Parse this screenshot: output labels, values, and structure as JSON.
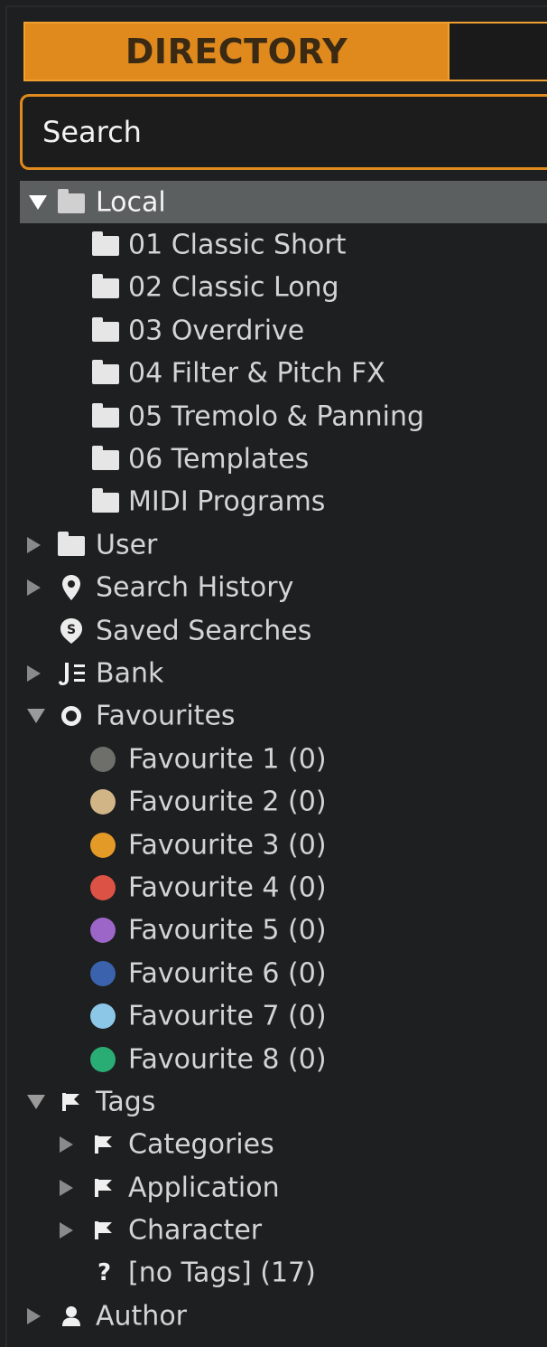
{
  "header": {
    "active_tab_label": "DIRECTORY"
  },
  "search": {
    "placeholder": "Search"
  },
  "tree": {
    "local": {
      "label": "Local",
      "children": [
        {
          "label": "01 Classic Short"
        },
        {
          "label": "02 Classic Long"
        },
        {
          "label": "03 Overdrive"
        },
        {
          "label": "04 Filter & Pitch FX"
        },
        {
          "label": "05 Tremolo & Panning"
        },
        {
          "label": "06 Templates"
        },
        {
          "label": "MIDI Programs"
        }
      ]
    },
    "user": {
      "label": "User"
    },
    "search_history": {
      "label": "Search History"
    },
    "saved_searches": {
      "label": "Saved Searches"
    },
    "bank": {
      "label": "Bank"
    },
    "favourites": {
      "label": "Favourites",
      "children": [
        {
          "label": "Favourite 1 (0)",
          "color": "#6e6e6a"
        },
        {
          "label": "Favourite 2 (0)",
          "color": "#d1b587"
        },
        {
          "label": "Favourite 3 (0)",
          "color": "#e49a26"
        },
        {
          "label": "Favourite 4 (0)",
          "color": "#dc5244"
        },
        {
          "label": "Favourite 5 (0)",
          "color": "#9b66c8"
        },
        {
          "label": "Favourite 6 (0)",
          "color": "#3a62ad"
        },
        {
          "label": "Favourite 7 (0)",
          "color": "#8cc7e8"
        },
        {
          "label": "Favourite 8 (0)",
          "color": "#2aad74"
        }
      ]
    },
    "tags": {
      "label": "Tags",
      "children": [
        {
          "label": "Categories"
        },
        {
          "label": "Application"
        },
        {
          "label": "Character"
        }
      ],
      "no_tags": {
        "label": "[no Tags] (17)"
      }
    },
    "author": {
      "label": "Author"
    }
  },
  "icons": {
    "folder": "folder-icon",
    "pin": "location-pin-icon",
    "saved_search": "saved-search-badge-icon",
    "bank": "bank-list-icon",
    "favourite": "circle-ring-icon",
    "tag": "flag-icon",
    "question": "question-mark-icon",
    "author": "person-icon"
  },
  "colors": {
    "accent": "#e08a1e",
    "background": "#1e1f20",
    "selected_row": "#5b5f60"
  }
}
